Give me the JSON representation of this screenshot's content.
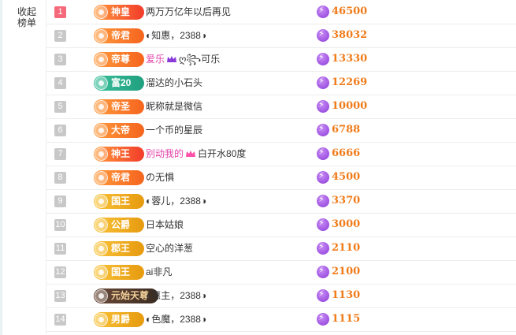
{
  "sidebar": {
    "collapse_line1": "收起",
    "collapse_line2": "榜单"
  },
  "colors": {
    "score": "#f07a18",
    "rank_top": "#f56a7a",
    "rank_default": "#c8c8c8",
    "pink_name": "#e23fa8"
  },
  "rows": [
    {
      "rank": "1",
      "badge": "神皇",
      "badge_style": "red",
      "name": "两万万亿年以后再见",
      "score": "46500"
    },
    {
      "rank": "2",
      "badge": "帝君",
      "badge_style": "orange",
      "name": "◐知惠，2388◑",
      "score": "38032"
    },
    {
      "rank": "3",
      "badge": "帝尊",
      "badge_style": "orange",
      "name_pre": "爱乐",
      "name_post": "ღ꧂可乐",
      "crown_color": "#8a3ad8",
      "score": "13330"
    },
    {
      "rank": "4",
      "badge": "富20",
      "badge_style": "teal",
      "name": "溜达的小石头",
      "score": "12269"
    },
    {
      "rank": "5",
      "badge": "帝圣",
      "badge_style": "orange",
      "name": "昵称就是微信",
      "score": "10000"
    },
    {
      "rank": "6",
      "badge": "大帝",
      "badge_style": "orange",
      "name": "一个币的星辰",
      "score": "6788"
    },
    {
      "rank": "7",
      "badge": "神王",
      "badge_style": "red",
      "name_pre": "别动我的",
      "name_post": "白开水80度",
      "crown_color": "#ff4fa8",
      "score": "6666"
    },
    {
      "rank": "8",
      "badge": "帝君",
      "badge_style": "orange",
      "name": "の无惧",
      "score": "4500"
    },
    {
      "rank": "9",
      "badge": "国王",
      "badge_style": "gold",
      "name": "◐蓉儿，2388◑",
      "score": "3370"
    },
    {
      "rank": "10",
      "badge": "公爵",
      "badge_style": "gold",
      "name": "日本姑娘",
      "score": "3000"
    },
    {
      "rank": "11",
      "badge": "郡王",
      "badge_style": "gold",
      "name": "空心的洋葱",
      "score": "2110"
    },
    {
      "rank": "12",
      "badge": "国王",
      "badge_style": "gold",
      "name": "ai非凡",
      "score": "2100"
    },
    {
      "rank": "13",
      "badge": "元始天尊",
      "badge_style": "dark",
      "name": "◐惠主，2388◑",
      "score": "1130"
    },
    {
      "rank": "14",
      "badge": "男爵",
      "badge_style": "gold",
      "name": "◐色魔，2388◑",
      "score": "1115"
    }
  ]
}
